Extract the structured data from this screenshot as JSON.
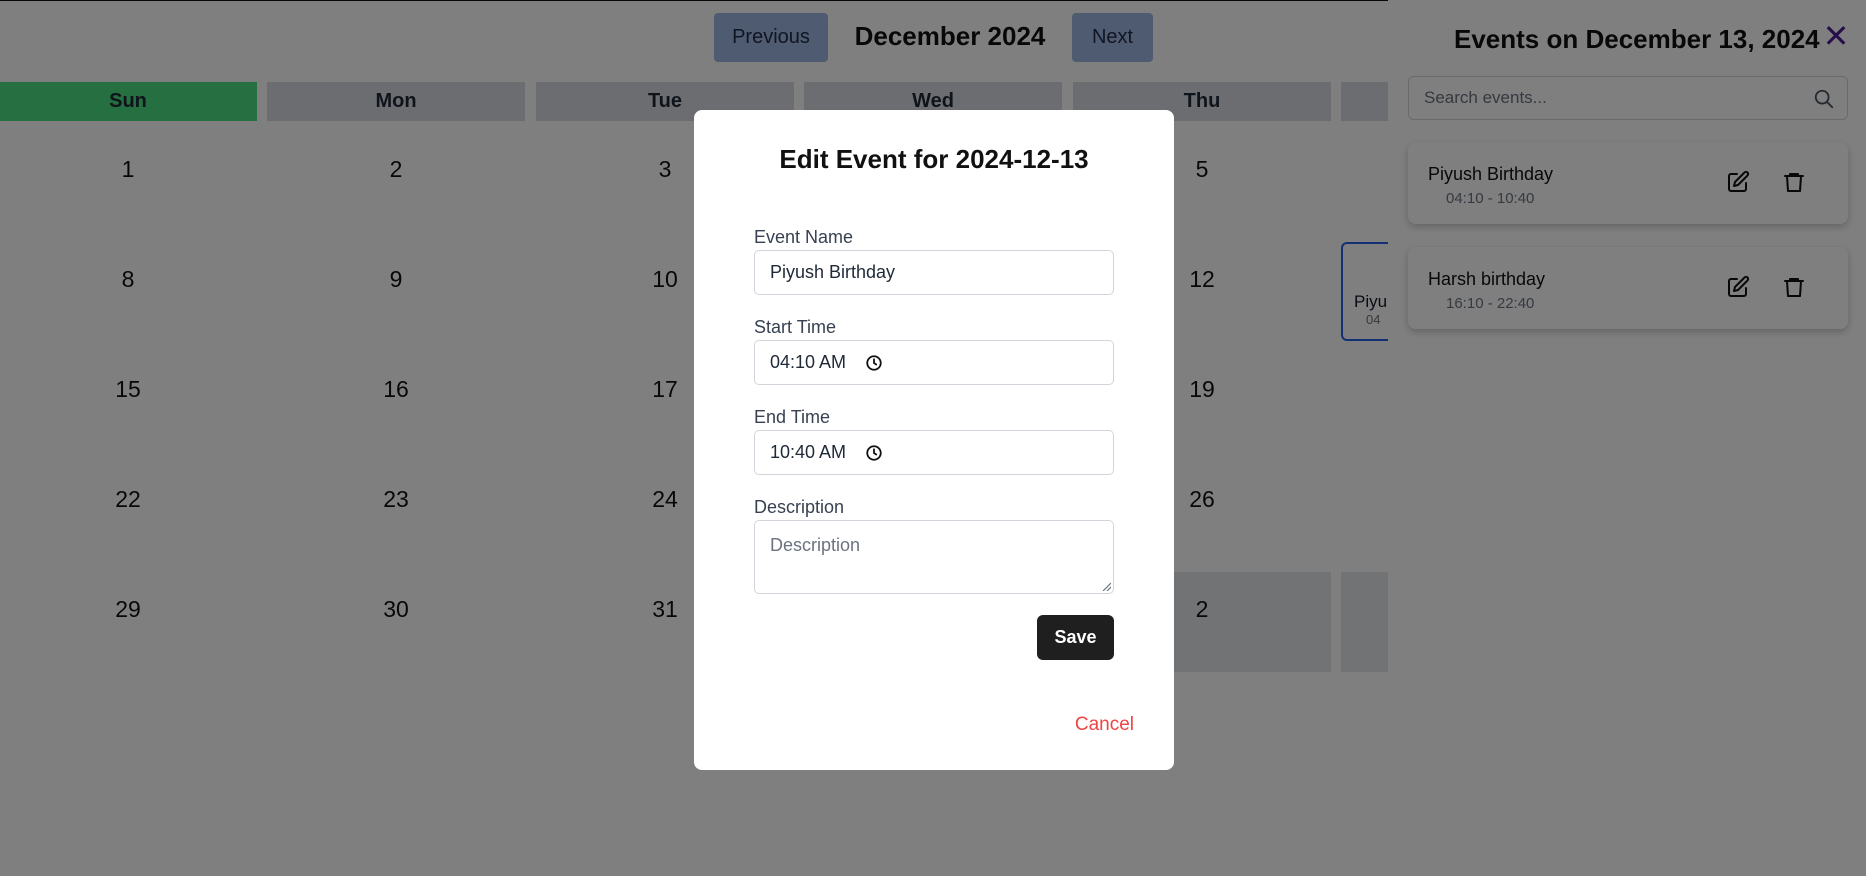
{
  "calendar": {
    "prev_label": "Previous",
    "next_label": "Next",
    "month_title": "December 2024",
    "weekdays": [
      "Sun",
      "Mon",
      "Tue",
      "Wed",
      "Thu"
    ],
    "weeks": [
      [
        "1",
        "2",
        "3",
        "",
        "5"
      ],
      [
        "8",
        "9",
        "10",
        "",
        "12"
      ],
      [
        "15",
        "16",
        "17",
        "",
        "19"
      ],
      [
        "22",
        "23",
        "24",
        "",
        "26"
      ],
      [
        "29",
        "30",
        "31",
        "",
        "2"
      ]
    ],
    "event_chip": {
      "name": "Piyu",
      "time": "04"
    },
    "colors": {
      "sunday": "#4ade80",
      "nav_button": "#9fb6e3",
      "selected_border": "#2563eb"
    }
  },
  "side_panel": {
    "title": "Events on December 13, 2024",
    "close_icon": "close-icon",
    "search_placeholder": "Search events...",
    "search_icon": "search-icon",
    "events": [
      {
        "name": "Piyush Birthday",
        "time": "04:10 - 10:40"
      },
      {
        "name": "Harsh birthday",
        "time": "16:10 - 22:40"
      }
    ]
  },
  "modal": {
    "title": "Edit Event for 2024-12-13",
    "event_name_label": "Event Name",
    "event_name_value": "Piyush Birthday",
    "start_time_label": "Start Time",
    "start_time_value": "04:10 AM",
    "end_time_label": "End Time",
    "end_time_value": "10:40 AM",
    "description_label": "Description",
    "description_placeholder": "Description",
    "save_label": "Save",
    "cancel_label": "Cancel",
    "colors": {
      "cancel": "#ef4444",
      "save_bg": "#1f1f1f"
    }
  }
}
